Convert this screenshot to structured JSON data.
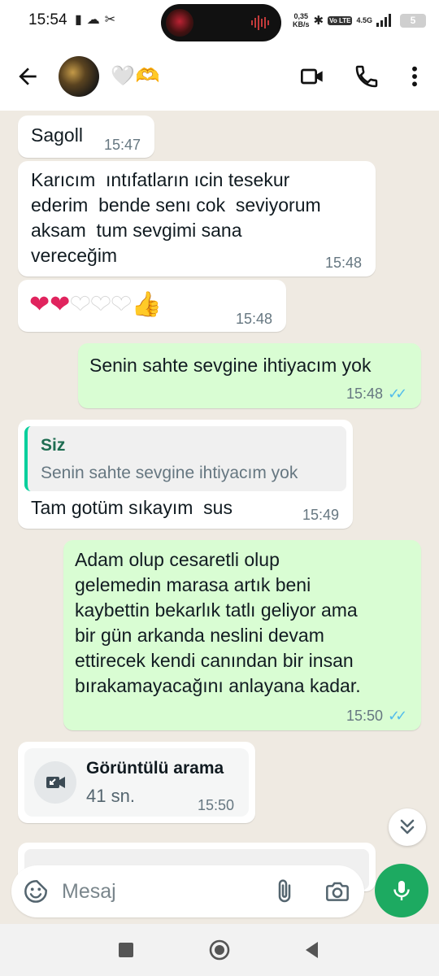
{
  "status_bar": {
    "time": "15:54",
    "left_icons": "▮☁✂",
    "speed_value": "0,35",
    "speed_unit": "KB/s",
    "bluetooth": "✱",
    "volte": "Vo LTE",
    "network": "4.5G",
    "battery": "5"
  },
  "header": {
    "contact_name": "🤍🫶",
    "avatar_icon": "contact-avatar",
    "video_icon": "video-call-icon",
    "voice_icon": "phone-icon",
    "menu_icon": "more-vert-icon"
  },
  "messages": [
    {
      "direction": "in",
      "text": "Sagoll",
      "time": "15:47"
    },
    {
      "direction": "in",
      "text": "Karıcım  ıntıfatların ıcin tesekur\nederim  bende senı cok  seviyorum\naksam  tum sevgimi sana\nvereceğim",
      "time": "15:48"
    },
    {
      "direction": "in",
      "text": "❤️‍🔥❤️‍🔥🤍🤍🤍👍",
      "time": "15:48"
    },
    {
      "direction": "out",
      "text": "Senin sahte sevgine ihtiyacım yok",
      "time": "15:48",
      "ticks": "✓✓"
    },
    {
      "direction": "in",
      "quote_author": "Siz",
      "quote_text": "Senin sahte sevgine ihtiyacım yok",
      "text": "Tam gotüm sıkayım  sus",
      "time": "15:49"
    },
    {
      "direction": "out",
      "text": "Adam olup cesaretli olup\ngelemedin marasa artık beni\nkaybettin bekarlık tatlı geliyor ama\nbir gün arkanda neslini devam\nettirecek kendi canından bir insan\nbırakamayacağını anlayana kadar.",
      "time": "15:50",
      "ticks": "✓✓"
    },
    {
      "direction": "in",
      "call_title": "Görüntülü arama",
      "call_duration": "41 sn.",
      "time": "15:50"
    }
  ],
  "input": {
    "placeholder": "Mesaj"
  },
  "colors": {
    "outgoing_bubble": "#d9fdd3",
    "incoming_bubble": "#ffffff",
    "chat_background": "#efeae2",
    "accent_green": "#1daa61",
    "read_ticks": "#53bdeb"
  }
}
